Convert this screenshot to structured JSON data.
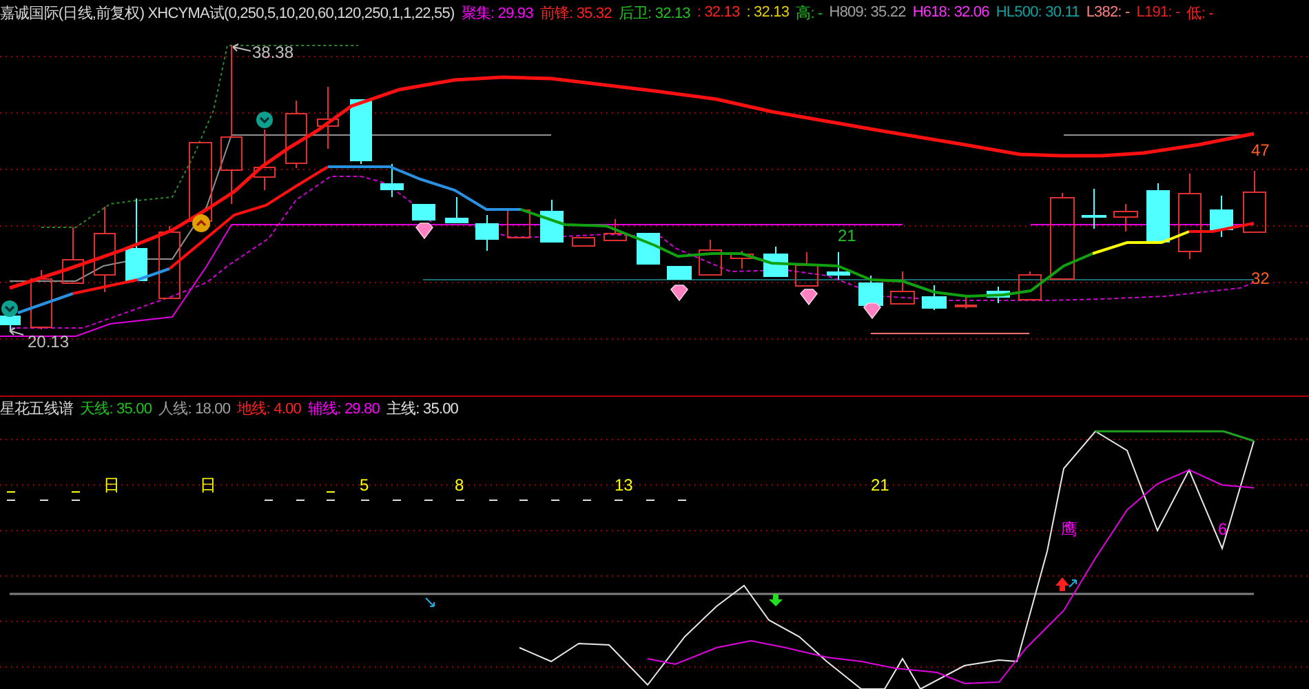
{
  "header": {
    "title": "嘉诚国际(日线,前复权) XHCYMA试(0,250,5,10,20,60,120,250,1,1,22,55)",
    "items": [
      {
        "text": "聚集: 29.93",
        "color": "#ff00ff"
      },
      {
        "text": "前锋: 35.32",
        "color": "#ff2020"
      },
      {
        "text": "后卫: 32.13",
        "color": "#20c020"
      },
      {
        "text": ": 32.13",
        "color": "#ff2020"
      },
      {
        "text": ": 32.13",
        "color": "#e6d200"
      },
      {
        "text": "高: -",
        "color": "#20c020"
      },
      {
        "text": "H809: 35.22",
        "color": "#a0a0a0"
      },
      {
        "text": "H618: 32.06",
        "color": "#ff30ff"
      },
      {
        "text": "HL500: 30.11",
        "color": "#12a0a0"
      },
      {
        "text": "L382: -",
        "color": "#ff8080"
      },
      {
        "text": "L191: -",
        "color": "#e02020"
      },
      {
        "text": "低: -",
        "color": "#ff2020"
      }
    ]
  },
  "main_chart": {
    "labels": [
      {
        "text": "38.38",
        "color": "#c0c0c0"
      },
      {
        "text": "20.13",
        "color": "#c0c0c0"
      },
      {
        "text": "21",
        "color": "#20c020"
      },
      {
        "text": "47",
        "color": "#ff6020"
      },
      {
        "text": "32",
        "color": "#ff6020"
      }
    ]
  },
  "lower_panel": {
    "title": "星花五线谱",
    "items": [
      {
        "text": "天线: 35.00",
        "color": "#20c020"
      },
      {
        "text": "人线: 18.00",
        "color": "#a0a0a0"
      },
      {
        "text": "地线: 4.00",
        "color": "#ff2020"
      },
      {
        "text": "辅线: 29.80",
        "color": "#ff00ff"
      },
      {
        "text": "主线: 35.00",
        "color": "#e0e0e0"
      }
    ],
    "labels": [
      {
        "text": "日",
        "color": "#ffff00"
      },
      {
        "text": "日",
        "color": "#ffff00"
      },
      {
        "text": "5",
        "color": "#ffff00"
      },
      {
        "text": "8",
        "color": "#ffff00"
      },
      {
        "text": "13",
        "color": "#ffff00"
      },
      {
        "text": "21",
        "color": "#ffff00"
      },
      {
        "text": "鹰",
        "color": "#ff00ff"
      },
      {
        "text": "6",
        "color": "#ff00ff"
      }
    ]
  }
}
